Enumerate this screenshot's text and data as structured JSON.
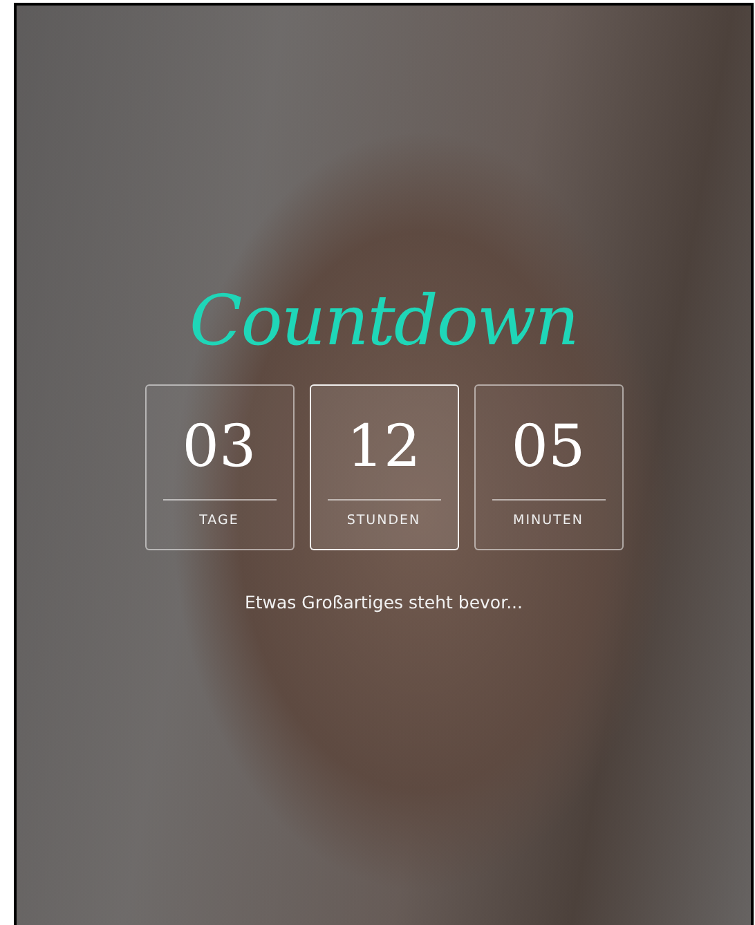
{
  "title": "Countdown",
  "units": [
    {
      "value": "03",
      "label": "TAGE",
      "highlighted": false
    },
    {
      "value": "12",
      "label": "STUNDEN",
      "highlighted": true
    },
    {
      "value": "05",
      "label": "MINUTEN",
      "highlighted": false
    }
  ],
  "tagline": "Etwas Großartiges steht bevor..."
}
